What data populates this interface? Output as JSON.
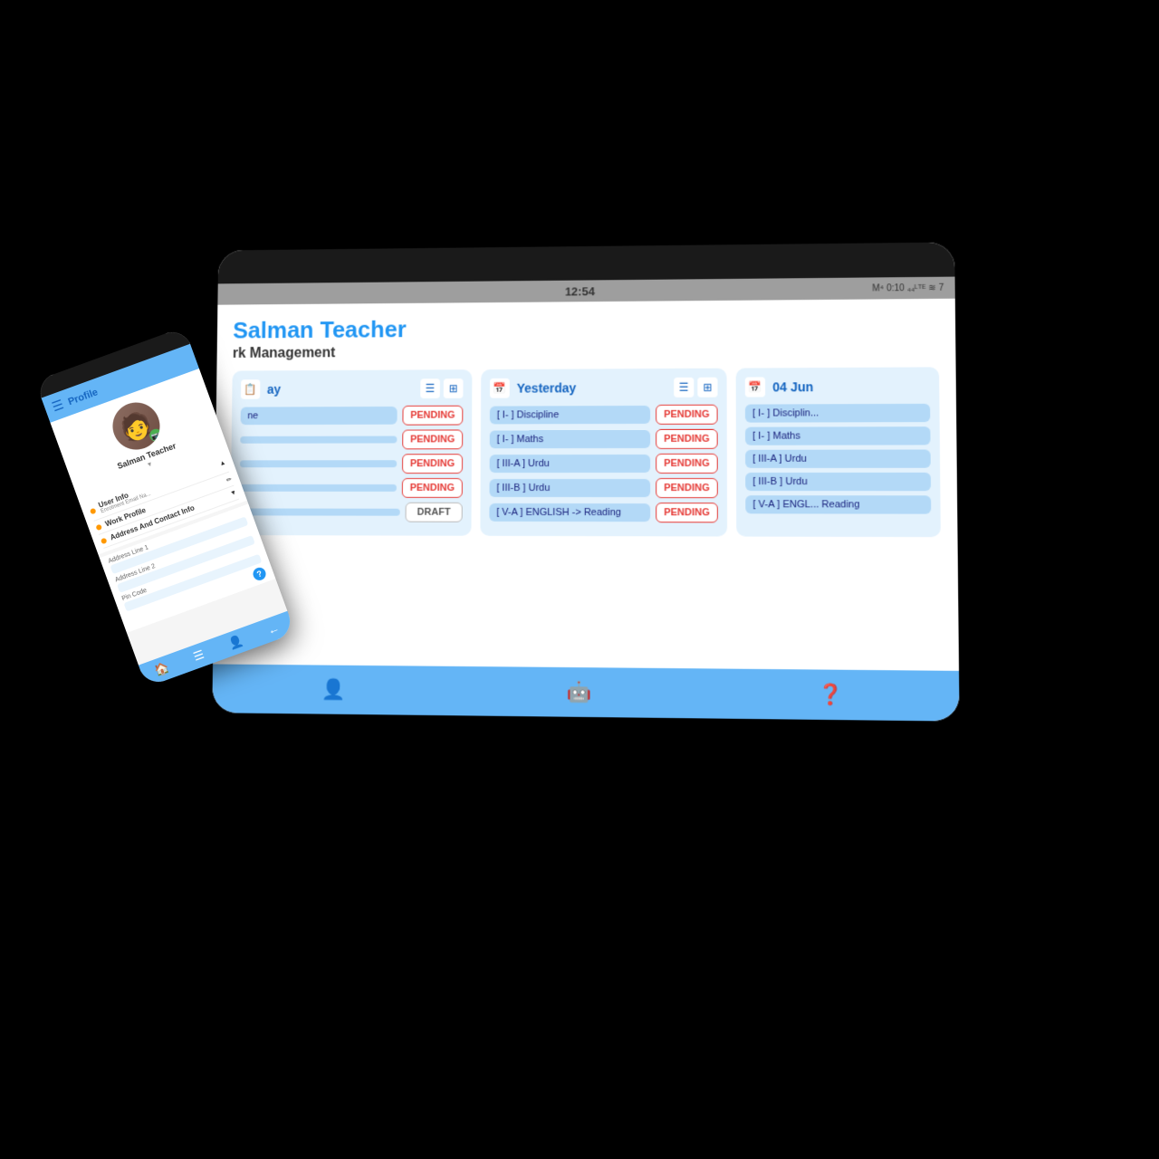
{
  "tablet": {
    "status_time": "12:54",
    "status_icons": "M 0:10  W 7",
    "teacher_name": "Salman Teacher",
    "section_title": "rk Management",
    "columns": [
      {
        "id": "today",
        "title": "ay",
        "rows": [
          {
            "subject": "ne",
            "badge": "PENDING",
            "badge_type": "pending"
          },
          {
            "subject": "",
            "badge": "PENDING",
            "badge_type": "pending"
          },
          {
            "subject": "",
            "badge": "PENDING",
            "badge_type": "pending"
          },
          {
            "subject": "",
            "badge": "PENDING",
            "badge_type": "pending"
          },
          {
            "subject": "",
            "badge": "DRAFT",
            "badge_type": "draft"
          }
        ]
      },
      {
        "id": "yesterday",
        "title": "Yesterday",
        "rows": [
          {
            "subject": "[ I- ] Discipline",
            "badge": "PENDING",
            "badge_type": "pending"
          },
          {
            "subject": "[ I- ] Maths",
            "badge": "PENDING",
            "badge_type": "pending"
          },
          {
            "subject": "[ III-A ] Urdu",
            "badge": "PENDING",
            "badge_type": "pending"
          },
          {
            "subject": "[ III-B ] Urdu",
            "badge": "PENDING",
            "badge_type": "pending"
          },
          {
            "subject": "[ V-A ] ENGLISH -> Reading",
            "badge": "PENDING",
            "badge_type": "pending"
          }
        ]
      },
      {
        "id": "04jun",
        "title": "04 Jun",
        "rows": [
          {
            "subject": "[ I- ] Disciplin...",
            "badge": "",
            "badge_type": ""
          },
          {
            "subject": "[ I- ] Maths",
            "badge": "",
            "badge_type": ""
          },
          {
            "subject": "[ III-A ] Urdu",
            "badge": "",
            "badge_type": ""
          },
          {
            "subject": "[ III-B ] Urdu",
            "badge": "",
            "badge_type": ""
          },
          {
            "subject": "[ V-A ] ENGL... Reading",
            "badge": "",
            "badge_type": ""
          }
        ]
      }
    ],
    "bottom_nav_icons": [
      "👤",
      "🤖",
      "❓"
    ]
  },
  "phone": {
    "header_title": "Profile",
    "username": "Salman Teacher",
    "menu_items": [
      {
        "label": "User Info",
        "sub": "Enrolment  Email Na...",
        "color": "#ff9800"
      },
      {
        "label": "Work Profile",
        "sub": "",
        "color": "#ff9800"
      },
      {
        "label": "Address And Contact Info",
        "sub": "",
        "color": "#ff9800"
      }
    ],
    "form": {
      "fields": [
        {
          "label": "Address Line 1",
          "value": ""
        },
        {
          "label": "Address Line 2",
          "value": ""
        },
        {
          "label": "Pin Code",
          "value": ""
        }
      ]
    },
    "bottom_nav_icons": [
      "🏠",
      "☰",
      "👤",
      "←"
    ]
  }
}
